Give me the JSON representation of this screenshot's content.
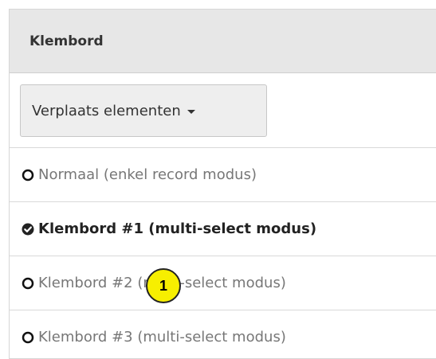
{
  "panel": {
    "title": "Klembord"
  },
  "toolbar": {
    "move_elements_label": "Verplaats elementen"
  },
  "options": [
    {
      "label": "Normaal (enkel record modus)",
      "selected": false,
      "icon": "circle-outline-icon"
    },
    {
      "label": "Klembord #1 (multi-select modus)",
      "selected": true,
      "icon": "check-circle-icon"
    },
    {
      "label": "Klembord #2 (multi-select modus)",
      "selected": false,
      "icon": "circle-outline-icon"
    },
    {
      "label": "Klembord #3 (multi-select modus)",
      "selected": false,
      "icon": "circle-outline-icon"
    }
  ],
  "annotation": {
    "marker_number": "1",
    "marker_color": "#f7ef00"
  }
}
